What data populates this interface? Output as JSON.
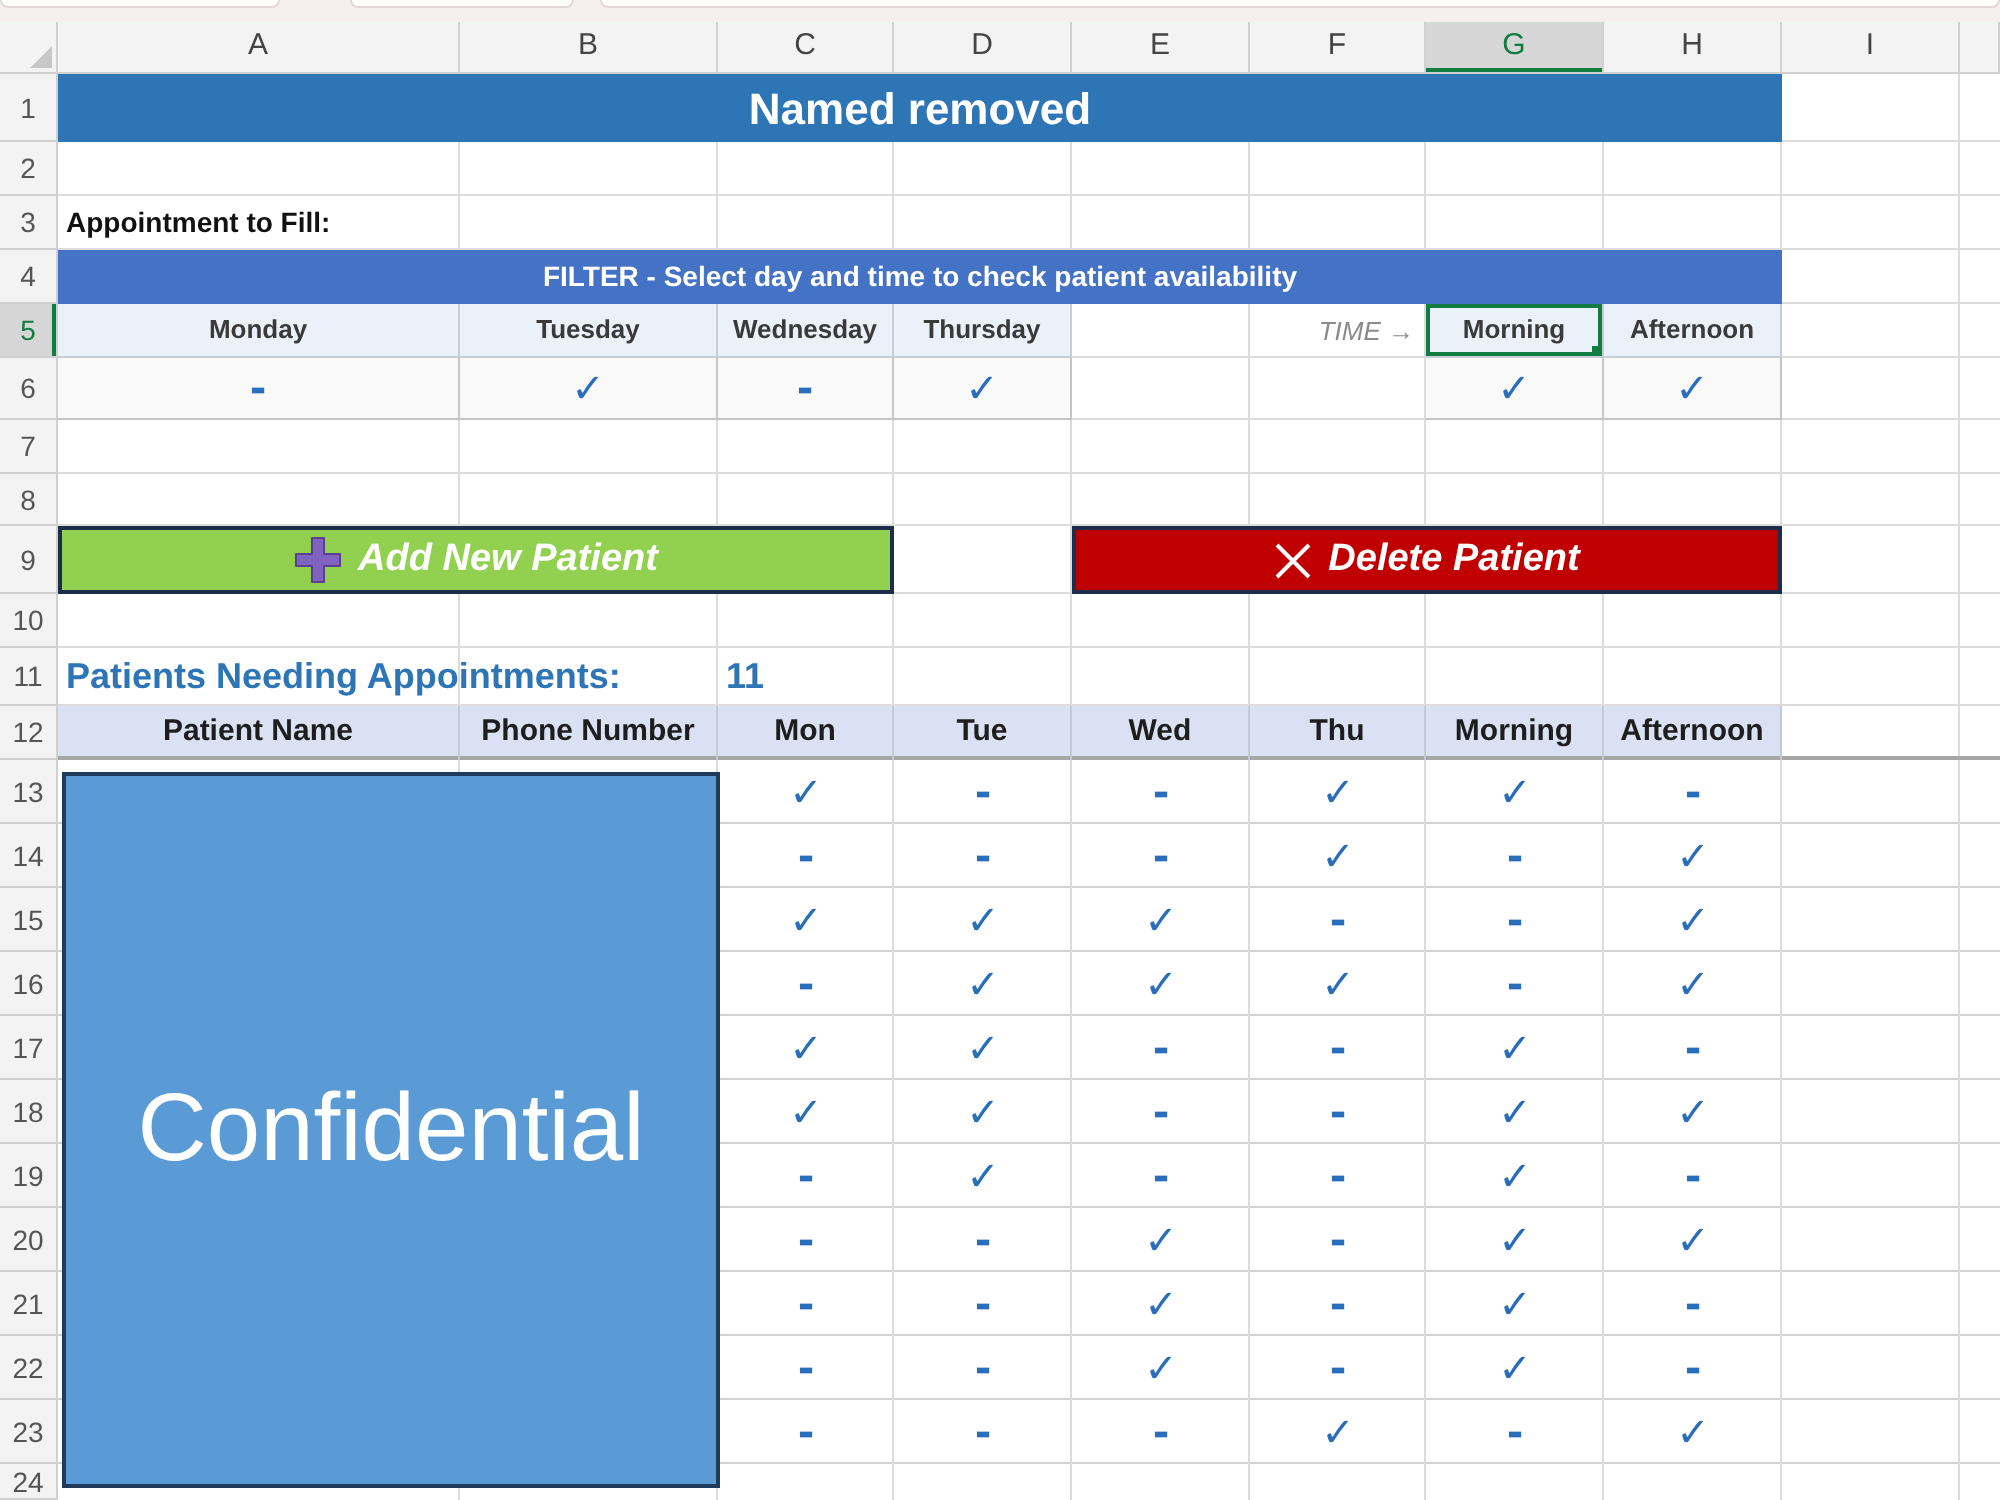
{
  "column_headers": [
    {
      "label": "A",
      "selected": false
    },
    {
      "label": "B",
      "selected": false
    },
    {
      "label": "C",
      "selected": false
    },
    {
      "label": "D",
      "selected": false
    },
    {
      "label": "E",
      "selected": false
    },
    {
      "label": "F",
      "selected": false
    },
    {
      "label": "G",
      "selected": true
    },
    {
      "label": "H",
      "selected": false
    },
    {
      "label": "I",
      "selected": false
    }
  ],
  "row_headers": [
    {
      "label": "1",
      "selected": false
    },
    {
      "label": "2",
      "selected": false
    },
    {
      "label": "3",
      "selected": false
    },
    {
      "label": "4",
      "selected": false
    },
    {
      "label": "5",
      "selected": true
    },
    {
      "label": "6",
      "selected": false
    },
    {
      "label": "7",
      "selected": false
    },
    {
      "label": "8",
      "selected": false
    },
    {
      "label": "9",
      "selected": false
    },
    {
      "label": "10",
      "selected": false
    },
    {
      "label": "11",
      "selected": false
    },
    {
      "label": "12",
      "selected": false
    },
    {
      "label": "13",
      "selected": false
    },
    {
      "label": "14",
      "selected": false
    },
    {
      "label": "15",
      "selected": false
    },
    {
      "label": "16",
      "selected": false
    },
    {
      "label": "17",
      "selected": false
    },
    {
      "label": "18",
      "selected": false
    },
    {
      "label": "19",
      "selected": false
    },
    {
      "label": "20",
      "selected": false
    },
    {
      "label": "21",
      "selected": false
    },
    {
      "label": "22",
      "selected": false
    },
    {
      "label": "23",
      "selected": false
    },
    {
      "label": "24",
      "selected": false
    }
  ],
  "title": "Named removed",
  "appointment_label": "Appointment to Fill:",
  "filter": {
    "banner": "FILTER - Select day and time to check patient availability",
    "days": [
      {
        "label": "Monday",
        "value": "-",
        "selected": false
      },
      {
        "label": "Tuesday",
        "value": "✓",
        "selected": false
      },
      {
        "label": "Wednesday",
        "value": "-",
        "selected": false
      },
      {
        "label": "Thursday",
        "value": "✓",
        "selected": false
      }
    ],
    "time_label": "TIME →",
    "times": [
      {
        "label": "Morning",
        "value": "✓",
        "selected": true
      },
      {
        "label": "Afternoon",
        "value": "✓",
        "selected": false
      }
    ]
  },
  "buttons": [
    {
      "kind": "add",
      "label": "Add New Patient"
    },
    {
      "kind": "delete",
      "label": "Delete Patient"
    }
  ],
  "patients_count": {
    "label": "Patients Needing Appointments:",
    "value": "11"
  },
  "table": {
    "columns": [
      "Patient Name",
      "Phone Number",
      "Mon",
      "Tue",
      "Wed",
      "Thu",
      "Morning",
      "Afternoon"
    ],
    "rows": [
      {
        "cells": [
          "",
          "",
          "✓",
          "-",
          "-",
          "✓",
          "✓",
          "-"
        ]
      },
      {
        "cells": [
          "",
          "",
          "-",
          "-",
          "-",
          "✓",
          "-",
          "✓"
        ]
      },
      {
        "cells": [
          "",
          "",
          "✓",
          "✓",
          "✓",
          "-",
          "-",
          "✓"
        ]
      },
      {
        "cells": [
          "",
          "",
          "-",
          "✓",
          "✓",
          "✓",
          "-",
          "✓"
        ]
      },
      {
        "cells": [
          "",
          "",
          "✓",
          "✓",
          "-",
          "-",
          "✓",
          "-"
        ]
      },
      {
        "cells": [
          "",
          "",
          "✓",
          "✓",
          "-",
          "-",
          "✓",
          "✓"
        ]
      },
      {
        "cells": [
          "",
          "",
          "-",
          "✓",
          "-",
          "-",
          "✓",
          "-"
        ]
      },
      {
        "cells": [
          "",
          "",
          "-",
          "-",
          "✓",
          "-",
          "✓",
          "✓"
        ]
      },
      {
        "cells": [
          "",
          "",
          "-",
          "-",
          "✓",
          "-",
          "✓",
          "-"
        ]
      },
      {
        "cells": [
          "",
          "",
          "-",
          "-",
          "✓",
          "-",
          "✓",
          "-"
        ]
      },
      {
        "cells": [
          "",
          "",
          "-",
          "-",
          "-",
          "✓",
          "-",
          "✓"
        ]
      }
    ]
  },
  "overlay": {
    "text": "Confidential"
  }
}
